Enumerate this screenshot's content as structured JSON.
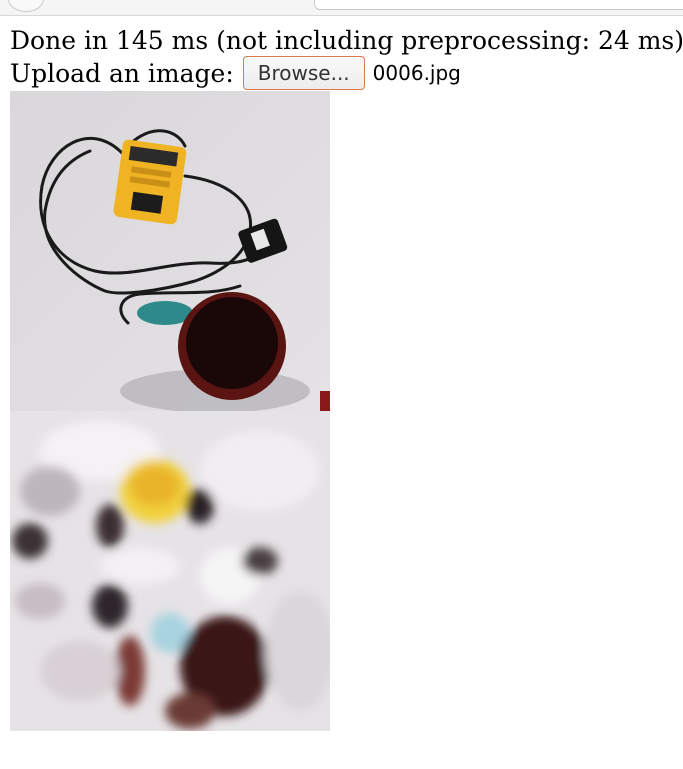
{
  "status": {
    "text": "Done in 145 ms (not including preprocessing: 24 ms)"
  },
  "upload": {
    "label": "Upload an image:",
    "button_label": "Browse...",
    "file_name": "0006.jpg"
  },
  "images": {
    "input_alt": "uploaded input photo",
    "output_alt": "processed output image"
  }
}
